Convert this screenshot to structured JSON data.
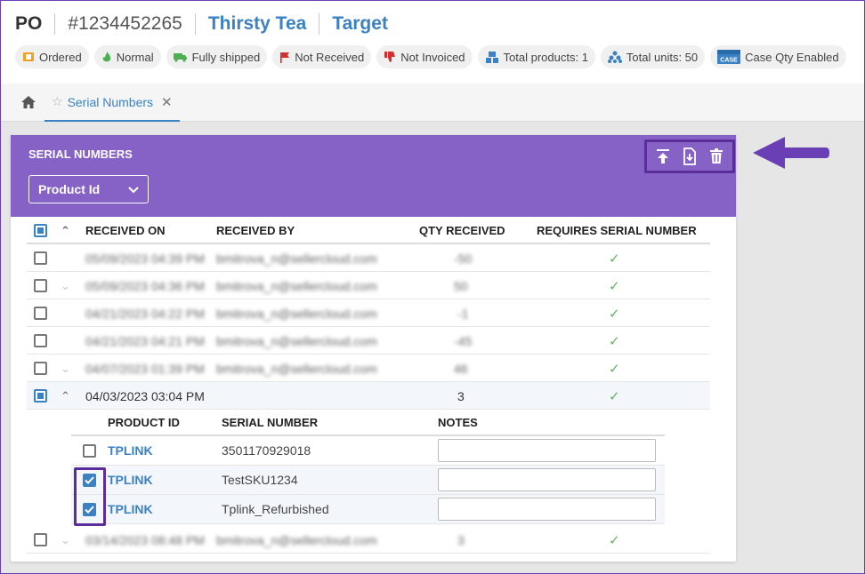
{
  "header": {
    "po_label": "PO",
    "po_number": "#1234452265",
    "vendor": "Thirsty Tea",
    "warehouse": "Target",
    "badges": [
      {
        "icon": "box-icon",
        "label": "Ordered",
        "color": "#f0a020"
      },
      {
        "icon": "flame-icon",
        "label": "Normal",
        "color": "#4caf50"
      },
      {
        "icon": "truck-icon",
        "label": "Fully shipped",
        "color": "#4caf50"
      },
      {
        "icon": "flag-icon",
        "label": "Not Received",
        "color": "#d32f2f"
      },
      {
        "icon": "thumbs-down-icon",
        "label": "Not Invoiced",
        "color": "#d32f2f"
      },
      {
        "icon": "products-icon",
        "label": "Total products: 1",
        "color": "#3b82c4"
      },
      {
        "icon": "units-icon",
        "label": "Total units: 50",
        "color": "#3b82c4"
      },
      {
        "icon": "case-icon",
        "label": "Case Qty Enabled",
        "color": "#3b82c4"
      }
    ]
  },
  "tabs": {
    "home_icon": "home-icon",
    "active_tab": "Serial Numbers"
  },
  "panel": {
    "title": "SERIAL NUMBERS",
    "dropdown_value": "Product Id",
    "actions": [
      "upload-icon",
      "import-file-icon",
      "trash-icon"
    ],
    "accent_color": "#8662c7",
    "highlight_color": "#5a2d9b"
  },
  "table": {
    "columns": [
      "RECEIVED ON",
      "RECEIVED BY",
      "QTY RECEIVED",
      "REQUIRES SERIAL NUMBER"
    ],
    "rows": [
      {
        "received_on": "05/09/2023 04:39 PM",
        "received_by": "bmitrova_n@sellercloud.com",
        "qty": "-50",
        "blurred": true
      },
      {
        "received_on": "05/09/2023 04:36 PM",
        "received_by": "bmitrova_n@sellercloud.com",
        "qty": "50",
        "blurred": true
      },
      {
        "received_on": "04/21/2023 04:22 PM",
        "received_by": "bmitrova_n@sellercloud.com",
        "qty": "-1",
        "blurred": true
      },
      {
        "received_on": "04/21/2023 04:21 PM",
        "received_by": "bmitrova_n@sellercloud.com",
        "qty": "-45",
        "blurred": true
      },
      {
        "received_on": "04/07/2023 01:39 PM",
        "received_by": "bmitrova_n@sellercloud.com",
        "qty": "46",
        "blurred": true
      },
      {
        "received_on": "04/03/2023 03:04 PM",
        "received_by": "",
        "qty": "3",
        "blurred": false
      },
      {
        "received_on": "03/14/2023 08:48 PM",
        "received_by": "bmitrova_n@sellercloud.com",
        "qty": "3",
        "blurred": true
      }
    ]
  },
  "serials": {
    "columns": [
      "PRODUCT ID",
      "SERIAL NUMBER",
      "NOTES"
    ],
    "rows": [
      {
        "product_id": "TPLINK",
        "serial": "3501170929018",
        "notes": "",
        "checked": false
      },
      {
        "product_id": "TPLINK",
        "serial": "TestSKU1234",
        "notes": "",
        "checked": true
      },
      {
        "product_id": "TPLINK",
        "serial": "Tplink_Refurbished",
        "notes": "",
        "checked": true
      }
    ]
  }
}
